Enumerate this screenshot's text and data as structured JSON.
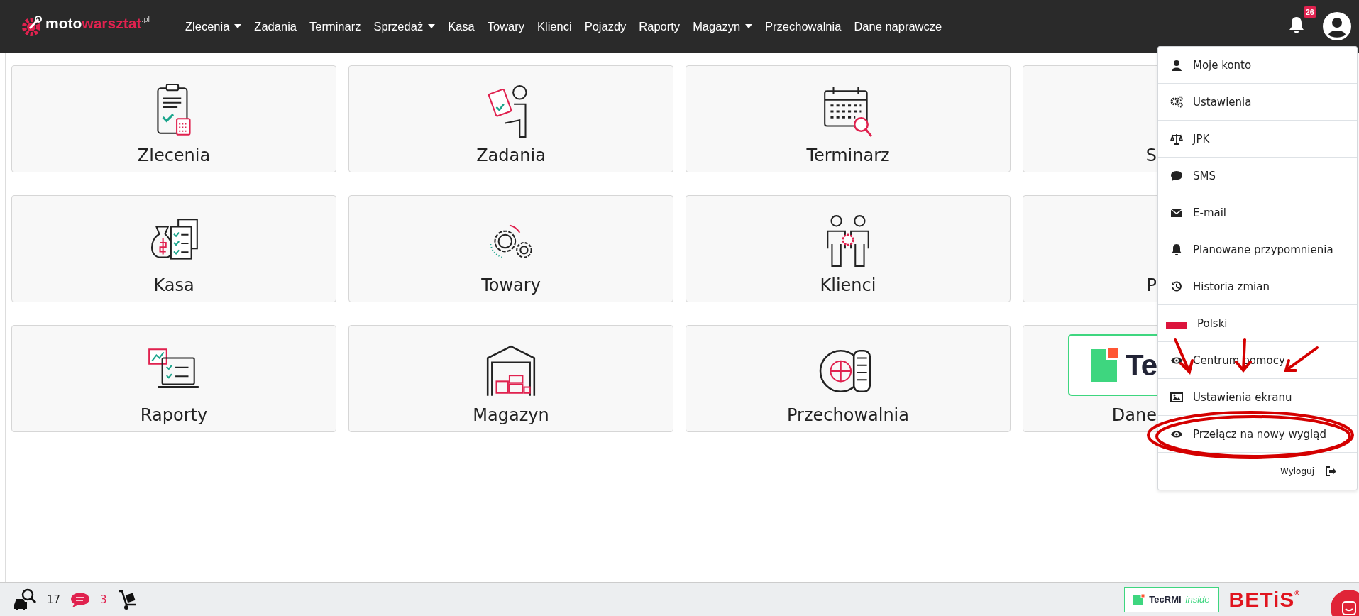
{
  "nav": {
    "logo": {
      "part_1": "moto",
      "part_2": "warsztat",
      "part_3": ".pl"
    },
    "items": [
      {
        "label": "Zlecenia",
        "has_menu": true
      },
      {
        "label": "Zadania",
        "has_menu": false
      },
      {
        "label": "Terminarz",
        "has_menu": false
      },
      {
        "label": "Sprzedaż",
        "has_menu": true
      },
      {
        "label": "Kasa",
        "has_menu": false
      },
      {
        "label": "Towary",
        "has_menu": false
      },
      {
        "label": "Klienci",
        "has_menu": false
      },
      {
        "label": "Pojazdy",
        "has_menu": false
      },
      {
        "label": "Raporty",
        "has_menu": false
      },
      {
        "label": "Magazyn",
        "has_menu": true
      },
      {
        "label": "Przechowalnia",
        "has_menu": false
      },
      {
        "label": "Dane naprawcze",
        "has_menu": false
      }
    ],
    "notifications": {
      "count": "26"
    }
  },
  "tiles": [
    {
      "label": "Zlecenia"
    },
    {
      "label": "Zadania"
    },
    {
      "label": "Terminarz"
    },
    {
      "label": "S"
    },
    {
      "label": "Kasa"
    },
    {
      "label": "Towary"
    },
    {
      "label": "Klienci"
    },
    {
      "label": "P"
    },
    {
      "label": "Raporty"
    },
    {
      "label": "Magazyn"
    },
    {
      "label": "Przechowalnia"
    },
    {
      "label": "Dane",
      "logo_text": "Te"
    }
  ],
  "user_menu": {
    "items": [
      {
        "kind": "link",
        "label": "Moje konto"
      },
      {
        "kind": "link",
        "label": "Ustawienia"
      },
      {
        "kind": "link",
        "label": "JPK"
      },
      {
        "kind": "link",
        "label": "SMS"
      },
      {
        "kind": "link",
        "label": "E-mail"
      },
      {
        "kind": "link",
        "label": "Planowane przypomnienia"
      },
      {
        "kind": "link",
        "label": "Historia zmian"
      },
      {
        "kind": "language",
        "label": "Polski"
      },
      {
        "kind": "link",
        "label": "Centrum pomocy"
      },
      {
        "kind": "link",
        "label": "Ustawienia ekranu"
      },
      {
        "kind": "link",
        "label": "Przełącz na nowy wygląd"
      },
      {
        "kind": "logout",
        "label": "Wyloguj"
      }
    ]
  },
  "status_bar": {
    "vehicles": "17",
    "sms": "3",
    "partner_logo": {
      "brand": "TecRMI",
      "suffix": "inside"
    },
    "betis_logo": {
      "name": "BETiS",
      "mark": "®"
    }
  }
}
